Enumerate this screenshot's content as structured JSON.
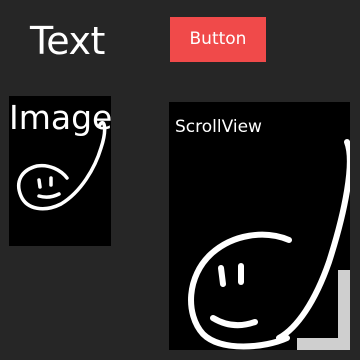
{
  "text_block": {
    "label": "Text"
  },
  "button": {
    "label": "Button",
    "color": "#f04a4a"
  },
  "image": {
    "caption": "Image",
    "icon": "smiley-swirl-icon"
  },
  "scroll_view": {
    "caption": "ScrollView",
    "icon": "smiley-swirl-icon"
  },
  "colors": {
    "background": "#262626",
    "panel": "#000000",
    "text": "#ffffff",
    "scrollbar": "#cfcfcf"
  }
}
